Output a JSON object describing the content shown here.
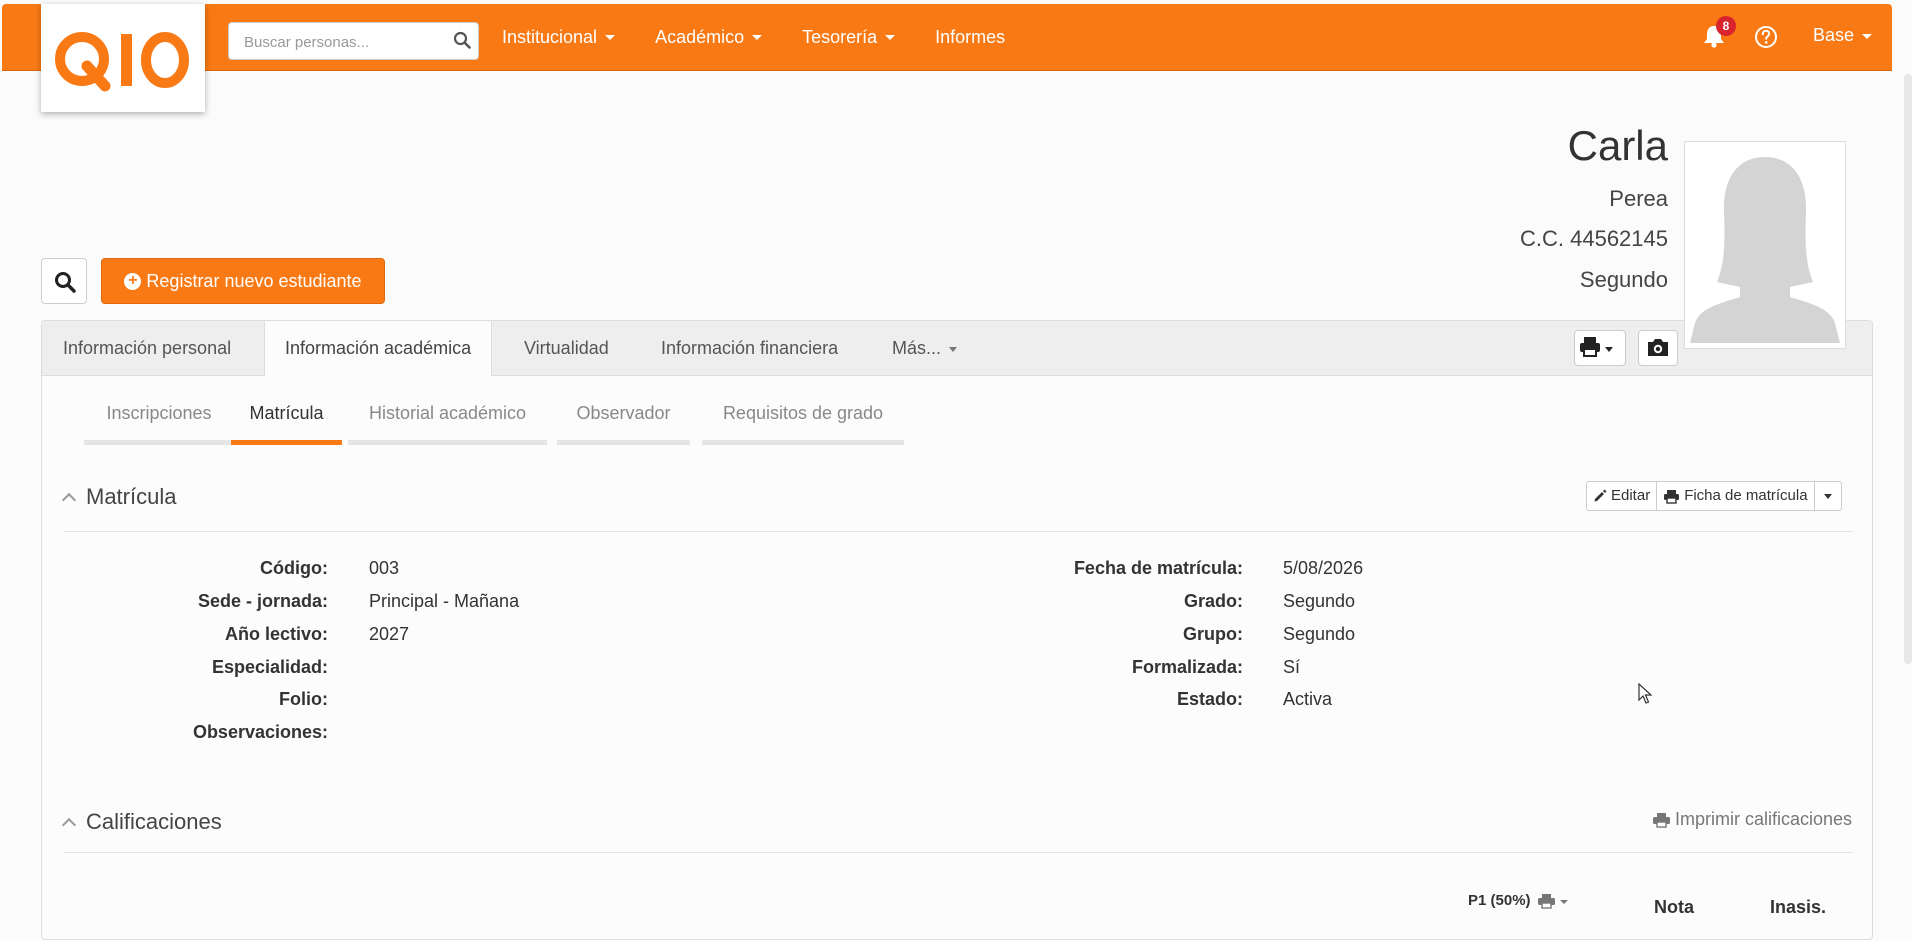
{
  "header": {
    "logo_text": "Q10",
    "search_placeholder": "Buscar personas...",
    "nav": [
      "Institucional",
      "Académico",
      "Tesorería",
      "Informes"
    ],
    "notification_count": "8",
    "base_label": "Base",
    "accent_color": "#f97a15"
  },
  "profile": {
    "first_name": "Carla",
    "last_name": "Perea",
    "id_doc": "C.C. 44562145",
    "grade": "Segundo"
  },
  "actions": {
    "register_label": "Registrar nuevo estudiante"
  },
  "tabs": [
    "Información personal",
    "Información académica",
    "Virtualidad",
    "Información financiera",
    "Más..."
  ],
  "subtabs": [
    "Inscripciones",
    "Matrícula",
    "Historial académico",
    "Observador",
    "Requisitos de grado"
  ],
  "matricula": {
    "title": "Matrícula",
    "edit_label": "Editar",
    "ficha_label": "Ficha de matrícula",
    "left": [
      {
        "label": "Código:",
        "value": "003"
      },
      {
        "label": "Sede - jornada:",
        "value": "Principal - Mañana"
      },
      {
        "label": "Año lectivo:",
        "value": "2027"
      },
      {
        "label": "Especialidad:",
        "value": ""
      },
      {
        "label": "Folio:",
        "value": ""
      },
      {
        "label": "Observaciones:",
        "value": ""
      }
    ],
    "right": [
      {
        "label": "Fecha de matrícula:",
        "value": "5/08/2026"
      },
      {
        "label": "Grado:",
        "value": "Segundo"
      },
      {
        "label": "Grupo:",
        "value": "Segundo"
      },
      {
        "label": "Formalizada:",
        "value": "Sí"
      },
      {
        "label": "Estado:",
        "value": "Activa"
      }
    ]
  },
  "calificaciones": {
    "title": "Calificaciones",
    "print_label": "Imprimir calificaciones",
    "period_label": "P1 (50%)",
    "columns": [
      "Nota",
      "Inasis."
    ]
  }
}
